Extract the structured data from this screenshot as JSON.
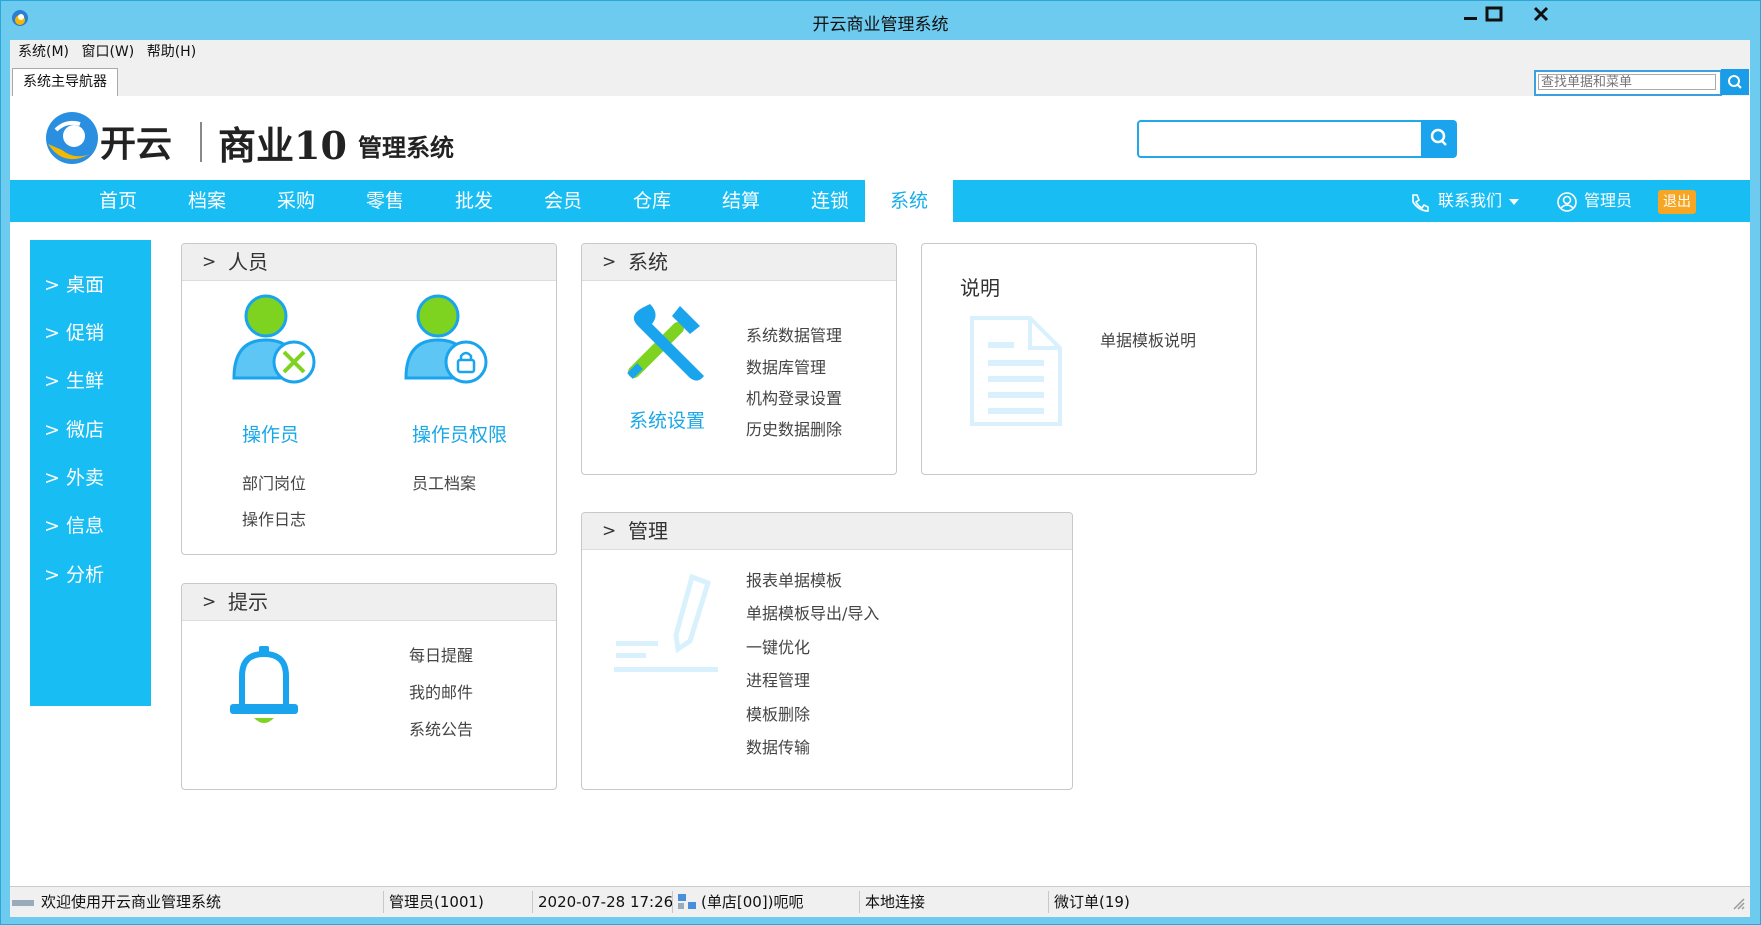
{
  "window": {
    "title": "开云商业管理系统"
  },
  "menubar": [
    "系统(M)",
    "窗口(W)",
    "帮助(H)"
  ],
  "tab": {
    "label": "系统主导航器"
  },
  "top_search": {
    "placeholder": "查找单据和菜单"
  },
  "logo": {
    "brand": "开云",
    "product": "商业10",
    "suffix": "管理系统"
  },
  "main_search": {
    "placeholder": ""
  },
  "nav": {
    "items": [
      "首页",
      "档案",
      "采购",
      "零售",
      "批发",
      "会员",
      "仓库",
      "结算",
      "连锁",
      "系统"
    ],
    "active": "系统",
    "contact": "联系我们",
    "user": "管理员",
    "exit": "退出"
  },
  "sidemenu": [
    "> 桌面",
    "> 促销",
    "> 生鲜",
    "> 微店",
    "> 外卖",
    "> 信息",
    "> 分析"
  ],
  "panels": {
    "personnel": {
      "title": "人员",
      "operator": "操作员",
      "operator_perm": "操作员权限",
      "links": [
        "部门岗位",
        "员工档案",
        "操作日志"
      ]
    },
    "system": {
      "title": "系统",
      "main_link": "系统设置",
      "links": [
        "系统数据管理",
        "数据库管理",
        "机构登录设置",
        "历史数据删除"
      ]
    },
    "notes": {
      "title": "说明",
      "link": "单据模板说明"
    },
    "tips": {
      "title": "提示",
      "links": [
        "每日提醒",
        "我的邮件",
        "系统公告"
      ]
    },
    "manage": {
      "title": "管理",
      "links": [
        "报表单据模板",
        "单据模板导出/导入",
        "一键优化",
        "进程管理",
        "模板删除",
        "数据传输"
      ]
    }
  },
  "statusbar": {
    "welcome": "欢迎使用开云商业管理系统",
    "user": "管理员(1001)",
    "datetime": "2020-07-28 17:26",
    "store": "(单店[00])呃呃",
    "connection": "本地连接",
    "orders": "微订单(19)"
  },
  "colors": {
    "accent": "#18bdf4",
    "exit": "#f6a623",
    "link": "#19a8e6"
  }
}
